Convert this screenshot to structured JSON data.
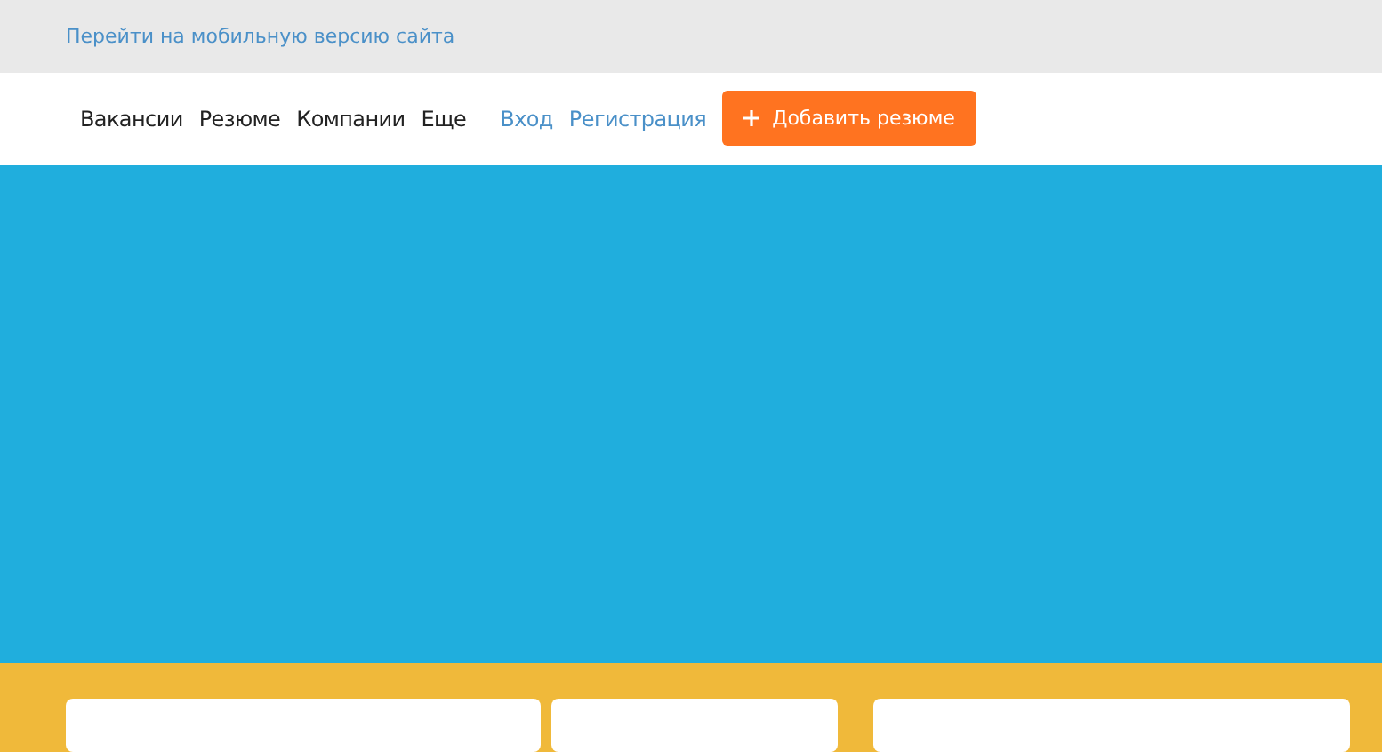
{
  "top_bar": {
    "mobile_link": "Перейти на мобильную версию сайта"
  },
  "nav": {
    "items": [
      "Вакансии",
      "Резюме",
      "Компании",
      "Еще"
    ],
    "auth_links": [
      "Вход",
      "Регистрация"
    ],
    "add_button": "Добавить резюме"
  },
  "search_fields": [
    {
      "kind": "field"
    },
    {
      "kind": "field"
    },
    {
      "kind": "field"
    }
  ]
}
